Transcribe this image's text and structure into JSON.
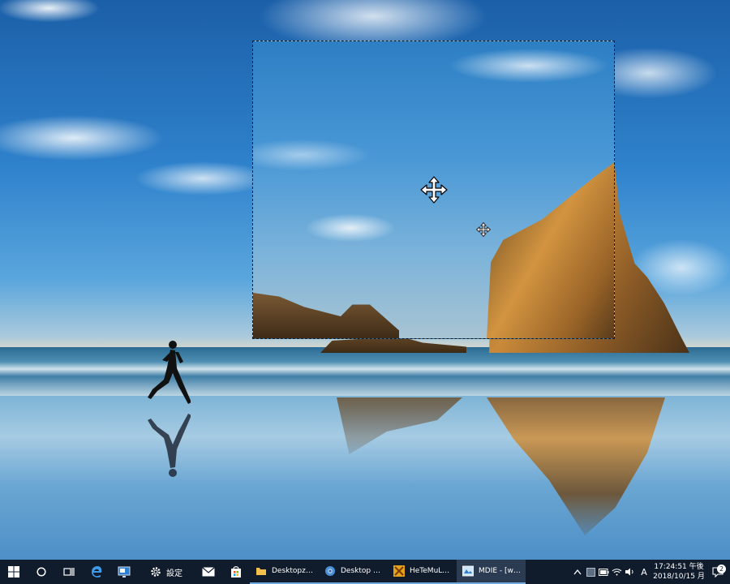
{
  "taskbar": {
    "settings_label": "設定",
    "apps": [
      {
        "label": "Desktopzoom...",
        "icon": "folder-icon"
      },
      {
        "label": "Desktop Appli...",
        "icon": "chrome-icon"
      },
      {
        "label": "HeTeMuLu Cr...",
        "icon": "hetemulu-icon"
      },
      {
        "label": "MDIE - [wallp...",
        "icon": "mdie-icon"
      }
    ],
    "ime_label": "A",
    "clock_time": "17:24:51 午後",
    "clock_date": "2018/10/15 月",
    "notification_count": "2"
  }
}
